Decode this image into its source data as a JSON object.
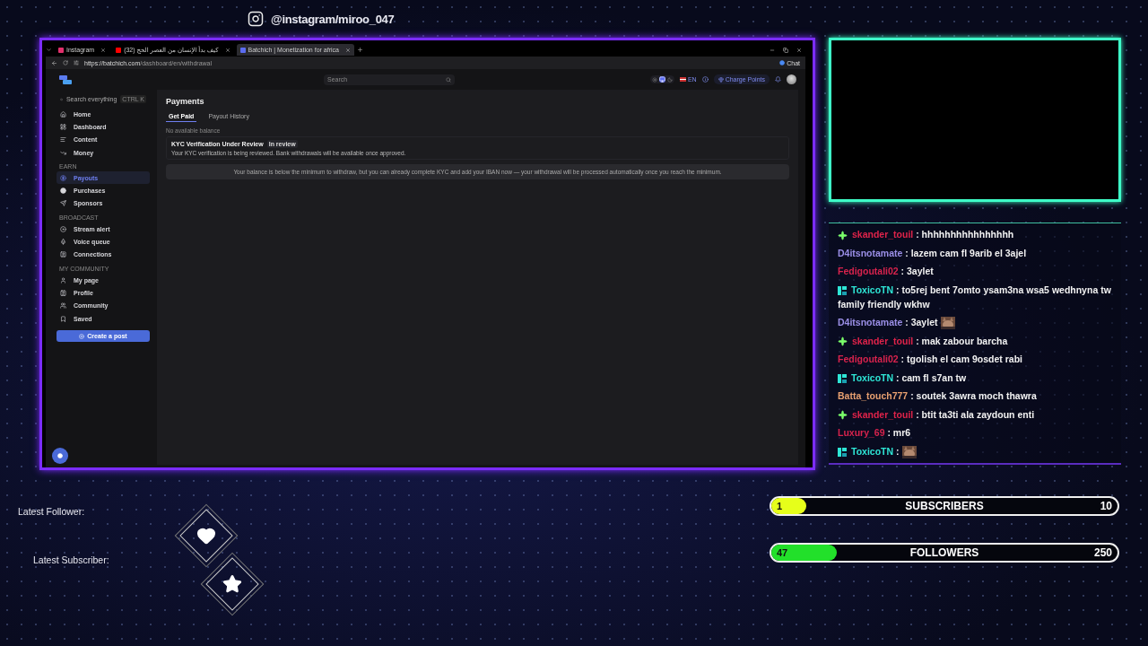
{
  "overlay": {
    "social_handle": "@instagram/miroo_047"
  },
  "browser": {
    "tabs": [
      {
        "title": "Instagram",
        "selected": false
      },
      {
        "title": "(32) كيف بدأ الإنسان من العصر الحج",
        "selected": false
      },
      {
        "title": "Batchich | Monetization for africa",
        "selected": true
      }
    ],
    "url_host": "https://batchich.com",
    "url_path": "/dashboard/en/withdrawal",
    "chat_button": "Chat"
  },
  "site": {
    "search_placeholder": "Search",
    "language": "EN",
    "charge_button": "Charge Points",
    "sidebar": {
      "search_placeholder": "Search everything",
      "shortcut": "CTRL K",
      "sections": [
        {
          "items": [
            {
              "label": "Home",
              "selected": false
            },
            {
              "label": "Dashboard",
              "selected": false
            },
            {
              "label": "Content",
              "selected": false
            },
            {
              "label": "Money",
              "selected": false
            }
          ]
        },
        {
          "heading": "EARN",
          "items": [
            {
              "label": "Payouts",
              "selected": true
            },
            {
              "label": "Purchases",
              "selected": false
            },
            {
              "label": "Sponsors",
              "selected": false
            }
          ]
        },
        {
          "heading": "BROADCAST",
          "items": [
            {
              "label": "Stream alert",
              "selected": false
            },
            {
              "label": "Voice queue",
              "selected": false
            },
            {
              "label": "Connections",
              "selected": false
            }
          ]
        },
        {
          "heading": "MY COMMUNITY",
          "items": [
            {
              "label": "My page",
              "selected": false
            },
            {
              "label": "Profile",
              "selected": false
            },
            {
              "label": "Community",
              "selected": false
            },
            {
              "label": "Saved",
              "selected": false
            }
          ]
        }
      ],
      "create_button": "Create a post"
    },
    "page": {
      "title": "Payments",
      "tabs": [
        {
          "label": "Get Paid",
          "selected": true
        },
        {
          "label": "Payout History",
          "selected": false
        }
      ],
      "balance_note": "No available balance",
      "kyc_card": {
        "title": "KYC Verification Under Review",
        "badge": "In review",
        "text": "Your KYC verification is being reviewed. Bank withdrawals will be available once approved."
      },
      "notice": "Your balance is below the minimum to withdraw, but you can already complete KYC and add your IBAN now — your withdrawal will be processed automatically once you reach the minimum."
    }
  },
  "chat": [
    {
      "user": "skander_touil",
      "color": "#e0234a",
      "kind": "sparkle",
      "text": ": hhhhhhhhhhhhhhhh"
    },
    {
      "user": "D4itsnotamate",
      "color": "#9a8ee6",
      "text": ": lazem cam fl 9arib el 3ajel"
    },
    {
      "user": "Fedigoutali02",
      "color": "#d8234d",
      "text": ": 3aylet"
    },
    {
      "user": "ToxicoTN",
      "color": "#2ee6d6",
      "kind": "partner",
      "text": ": to5rej bent 7omto ysam3na wsa5 wedhnyna tw family friendly wkhw"
    },
    {
      "user": "D4itsnotamate",
      "color": "#9a8ee6",
      "text": ": 3aylet",
      "emote": true
    },
    {
      "user": "skander_touil",
      "color": "#e0234a",
      "kind": "sparkle",
      "text": ": mak zabour barcha"
    },
    {
      "user": "Fedigoutali02",
      "color": "#d8234d",
      "text": ": tgolish el cam 9osdet rabi"
    },
    {
      "user": "ToxicoTN",
      "color": "#2ee6d6",
      "kind": "partner",
      "text": ": cam fl s7an tw"
    },
    {
      "user": "Batta_touch777",
      "color": "#e8a070",
      "text": ": soutek 3awra moch thawra"
    },
    {
      "user": "skander_touil",
      "color": "#e0234a",
      "kind": "sparkle",
      "text": ": btit ta3ti ala zaydoun enti"
    },
    {
      "user": "Luxury_69",
      "color": "#d8234d",
      "text": ": mr6"
    },
    {
      "user": "ToxicoTN",
      "color": "#2ee6d6",
      "kind": "partner",
      "text": ":",
      "emote": true
    }
  ],
  "latest": {
    "follower_label": "Latest Follower:",
    "subscriber_label": "Latest Subscriber:"
  },
  "goals": [
    {
      "label": "SUBSCRIBERS",
      "current": "1",
      "target": "10",
      "level": 0.1,
      "color": "#e6ff1a"
    },
    {
      "label": "FOLLOWERS",
      "current": "47",
      "target": "250",
      "level": 0.19,
      "color": "#22e02a"
    }
  ]
}
